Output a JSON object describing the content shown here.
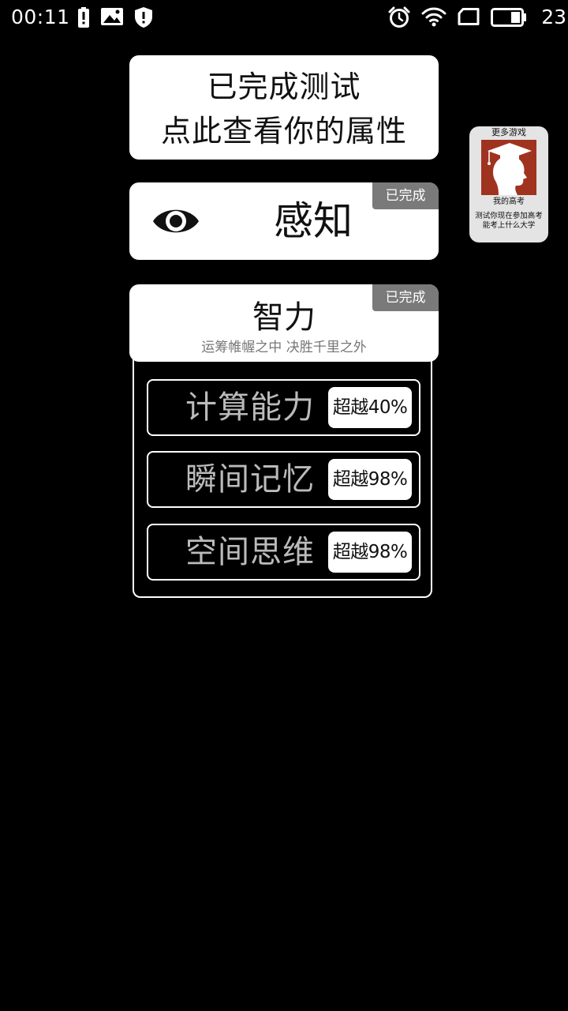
{
  "status_bar": {
    "time": "00:11",
    "battery_level": "23"
  },
  "header_card": {
    "line1": "已完成测试",
    "line2": "点此查看你的属性"
  },
  "perception_card": {
    "title": "感知",
    "badge": "已完成",
    "icon": "eye-icon"
  },
  "intelligence_card": {
    "title": "智力",
    "subtitle": "运筹帷幄之中 决胜千里之外",
    "badge": "已完成",
    "stats": [
      {
        "label": "计算能力",
        "value": "超越40%"
      },
      {
        "label": "瞬间记忆",
        "value": "超越98%"
      },
      {
        "label": "空间思维",
        "value": "超越98%"
      }
    ]
  },
  "promo": {
    "header": "更多游戏",
    "name": "我的高考",
    "description": "测试你现在参加高考能考上什么大学",
    "image_color": "#a0331f"
  }
}
